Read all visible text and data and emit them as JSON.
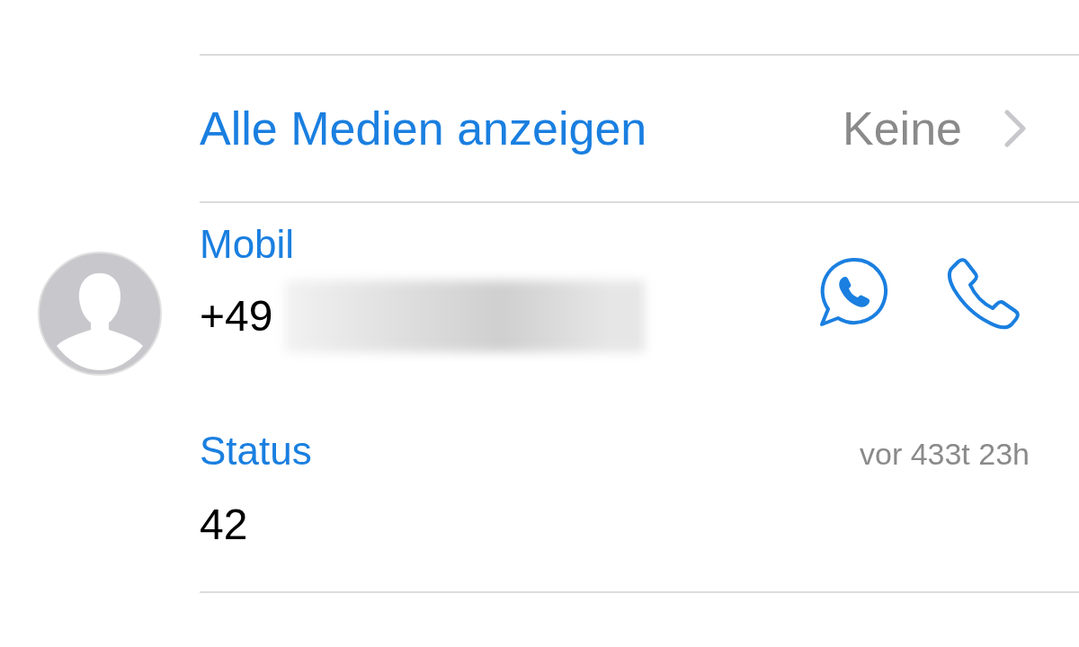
{
  "media_row": {
    "label": "Alle Medien anzeigen",
    "value": "Keine"
  },
  "phone": {
    "label": "Mobil",
    "number": "+49"
  },
  "status": {
    "label": "Status",
    "time": "vor 433t 23h",
    "text": "42"
  }
}
